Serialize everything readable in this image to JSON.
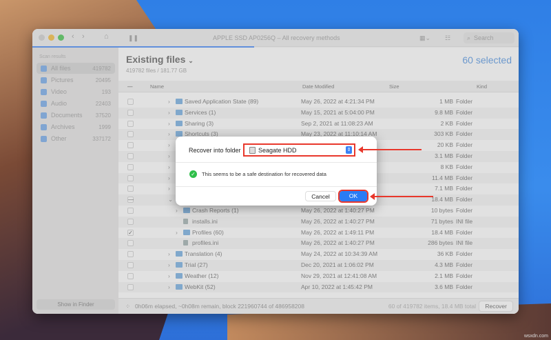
{
  "window": {
    "title": "APPLE SSD AP0256Q – All recovery methods",
    "search_placeholder": "Search"
  },
  "sidebar": {
    "heading": "Scan results",
    "items": [
      {
        "label": "All files",
        "count": "419782"
      },
      {
        "label": "Pictures",
        "count": "20495"
      },
      {
        "label": "Video",
        "count": "193"
      },
      {
        "label": "Audio",
        "count": "22403"
      },
      {
        "label": "Documents",
        "count": "37520"
      },
      {
        "label": "Archives",
        "count": "1999"
      },
      {
        "label": "Other",
        "count": "337172"
      }
    ],
    "show_in_finder": "Show in Finder"
  },
  "main": {
    "title": "Existing files",
    "subtitle": "419782 files / 181.77 GB",
    "selected": "60 selected",
    "columns": {
      "name": "Name",
      "date": "Date Modified",
      "size": "Size",
      "kind": "Kind"
    },
    "rows": [
      {
        "name": "Saved Application State (89)",
        "date": "May 26, 2022 at 4:21:34 PM",
        "size": "1 MB",
        "kind": "Folder"
      },
      {
        "name": "Services (1)",
        "date": "May 15, 2021 at 5:04:00 PM",
        "size": "9.8 MB",
        "kind": "Folder"
      },
      {
        "name": "Sharing (3)",
        "date": "Sep 2, 2021 at 11:08:23 AM",
        "size": "2 KB",
        "kind": "Folder"
      },
      {
        "name": "Shortcuts (3)",
        "date": "May 23, 2022 at 11:10:14 AM",
        "size": "303 KB",
        "kind": "Folder"
      },
      {
        "name": "",
        "date": "",
        "size": "20 KB",
        "kind": "Folder"
      },
      {
        "name": "",
        "date": "",
        "size": "3.1 MB",
        "kind": "Folder"
      },
      {
        "name": "",
        "date": "",
        "size": "8 KB",
        "kind": "Folder"
      },
      {
        "name": "",
        "date": "",
        "size": "11.4 MB",
        "kind": "Folder"
      },
      {
        "name": "",
        "date": "",
        "size": "7.1 MB",
        "kind": "Folder"
      },
      {
        "name": "",
        "date": "",
        "size": "18.4 MB",
        "kind": "Folder"
      },
      {
        "name": "Crash Reports (1)",
        "date": "May 26, 2022 at 1:40:27 PM",
        "size": "10 bytes",
        "kind": "Folder"
      },
      {
        "name": "installs.ini",
        "date": "May 26, 2022 at 1:40:27 PM",
        "size": "71 bytes",
        "kind": "INI file"
      },
      {
        "name": "Profiles (60)",
        "date": "May 26, 2022 at 1:49:11 PM",
        "size": "18.4 MB",
        "kind": "Folder"
      },
      {
        "name": "profiles.ini",
        "date": "May 26, 2022 at 1:40:27 PM",
        "size": "286 bytes",
        "kind": "INI file"
      },
      {
        "name": "Translation (4)",
        "date": "May 24, 2022 at 10:34:39 AM",
        "size": "36 KB",
        "kind": "Folder"
      },
      {
        "name": "Trial (27)",
        "date": "Dec 20, 2021 at 1:06:02 PM",
        "size": "4.3 MB",
        "kind": "Folder"
      },
      {
        "name": "Weather (12)",
        "date": "Nov 29, 2021 at 12:41:08 AM",
        "size": "2.1 MB",
        "kind": "Folder"
      },
      {
        "name": "WebKit (52)",
        "date": "Apr 10, 2022 at 1:45:42 PM",
        "size": "3.6 MB",
        "kind": "Folder"
      }
    ]
  },
  "footer": {
    "status": "0h06m elapsed, ~0h08m remain, block 221960744 of 486958208",
    "items": "60 of 419782 items, 18.4 MB total",
    "recover": "Recover"
  },
  "dialog": {
    "label": "Recover into folder",
    "destination": "Seagate HDD",
    "message": "This seems to be a safe destination for recovered data",
    "cancel": "Cancel",
    "ok": "OK"
  },
  "watermark": "wsxdn.com",
  "colors": {
    "accent": "#2a7cf5",
    "highlight": "#e8372b",
    "success": "#2fbf4a"
  }
}
